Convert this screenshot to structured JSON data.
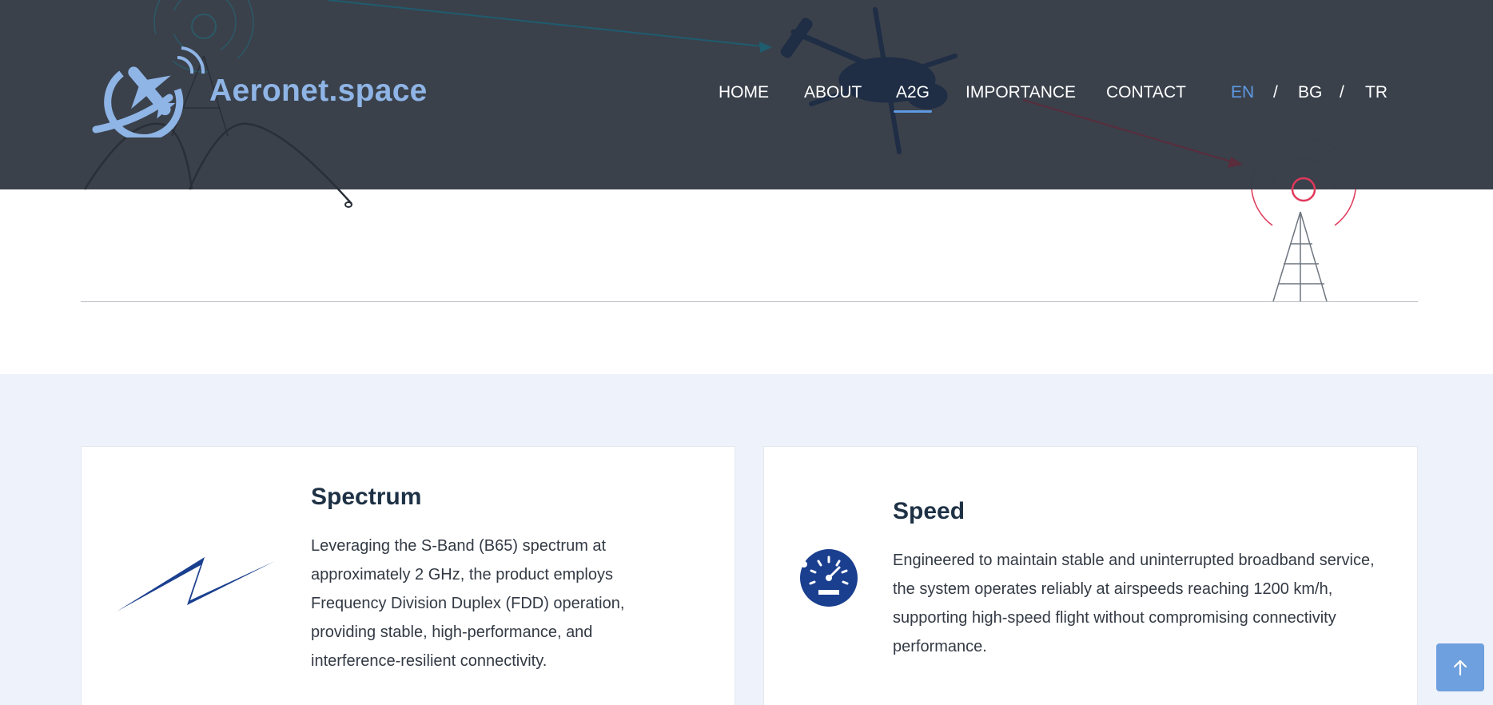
{
  "site": {
    "logo_text": "Aeronet.space"
  },
  "nav": {
    "items": [
      {
        "label": "HOME"
      },
      {
        "label": "ABOUT"
      },
      {
        "label": "A2G",
        "active": true
      },
      {
        "label": "IMPORTANCE"
      },
      {
        "label": "CONTACT"
      }
    ]
  },
  "languages": {
    "items": [
      {
        "label": "EN",
        "active": true
      },
      {
        "label": "BG"
      },
      {
        "label": "TR"
      }
    ],
    "separator": "/"
  },
  "features": [
    {
      "icon": "lightning-bolt-icon",
      "title": "Spectrum",
      "text": "Leveraging the S-Band (B65) spectrum at approximately 2 GHz, the product employs Frequency Division Duplex (FDD) operation, providing stable, high-performance, and interference-resilient connectivity."
    },
    {
      "icon": "speedometer-icon",
      "title": "Speed",
      "text": "Engineered to maintain stable and uninterrupted broadband service, the system operates reliably at airspeeds reaching 1200 km/h, supporting high-speed flight without compromising connectivity performance."
    }
  ],
  "scroll_top": {
    "icon": "arrow-up-icon"
  },
  "colors": {
    "header_bg": "#3a414b",
    "accent": "#5d9ae3",
    "logo": "#8fb4e6",
    "feature_bg": "#eef2fb",
    "icon_blue": "#1a3f8f",
    "signal_red": "#e0385a"
  }
}
